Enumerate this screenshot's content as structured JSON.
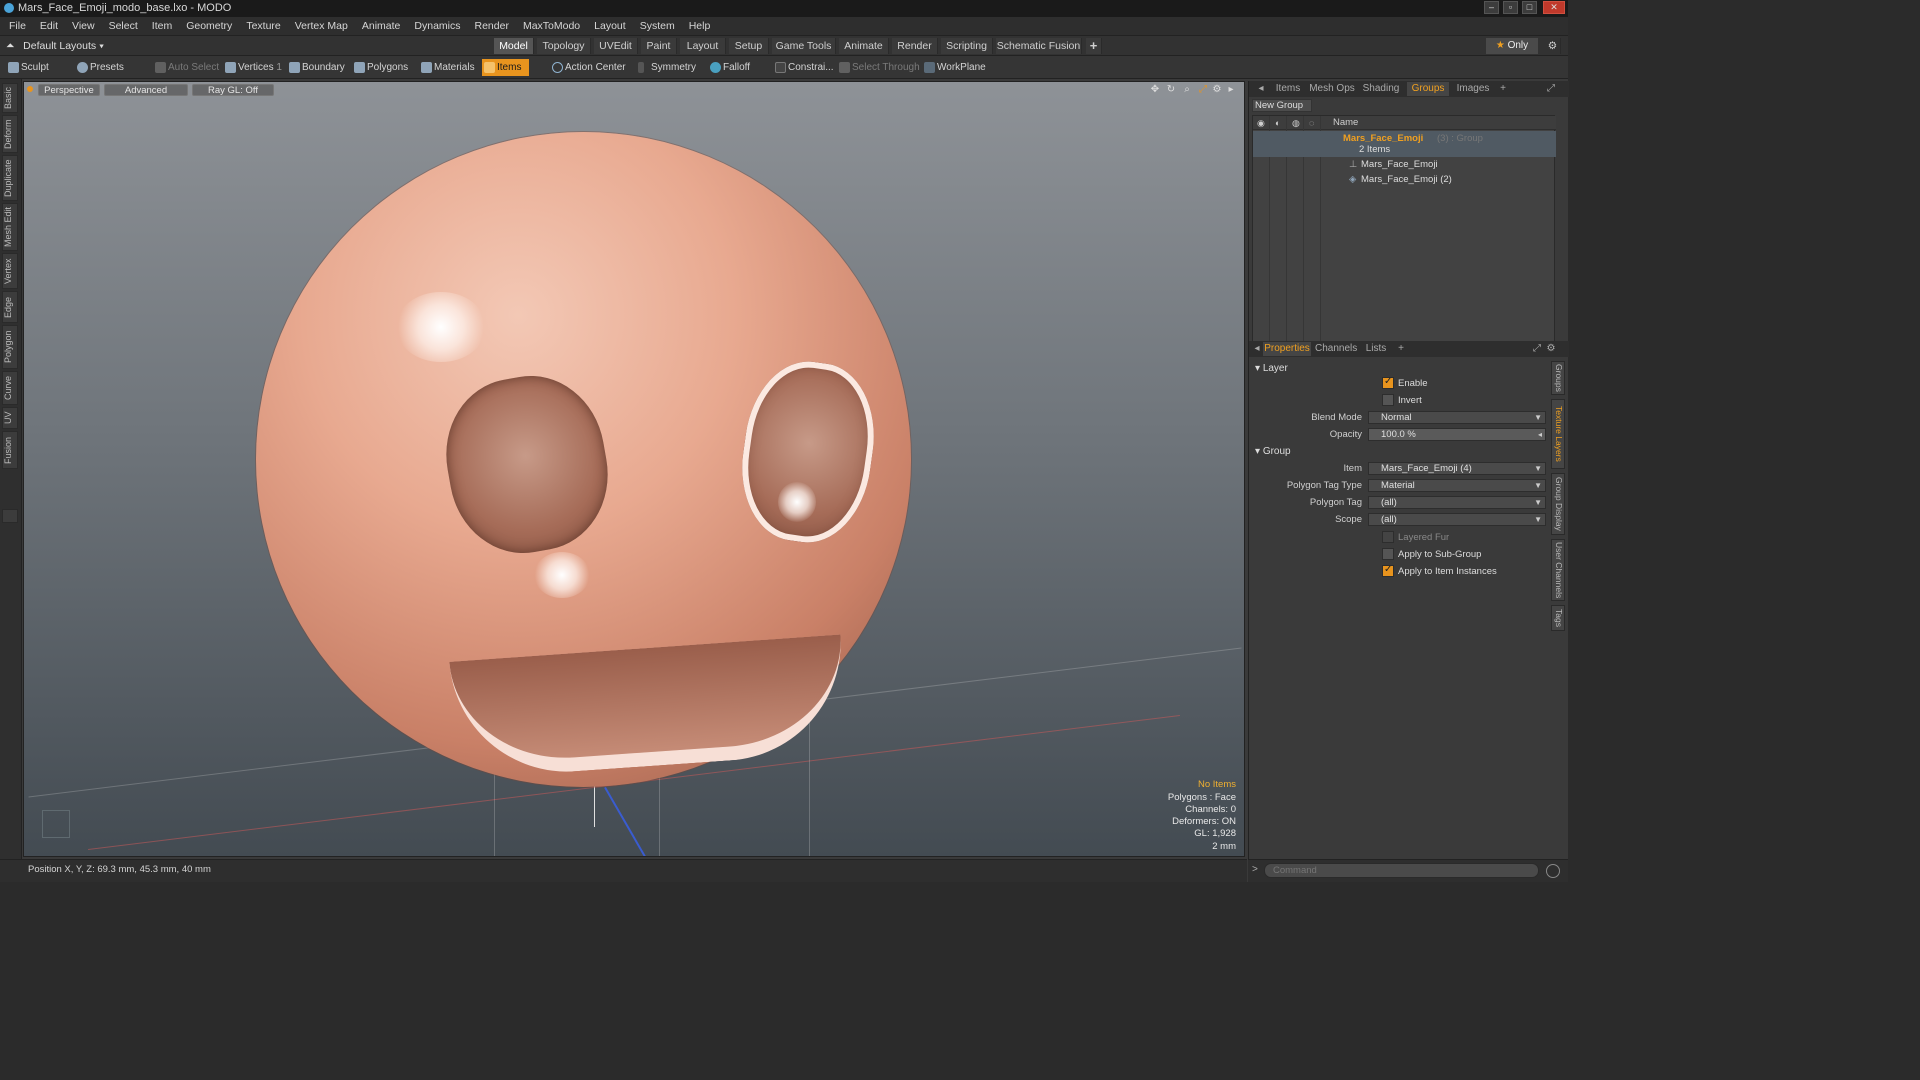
{
  "window": {
    "title": "Mars_Face_Emoji_modo_base.lxo - MODO"
  },
  "menu": [
    "File",
    "Edit",
    "View",
    "Select",
    "Item",
    "Geometry",
    "Texture",
    "Vertex Map",
    "Animate",
    "Dynamics",
    "Render",
    "MaxToModo",
    "Layout",
    "System",
    "Help"
  ],
  "layout_bar": {
    "layouts_label": "Default Layouts",
    "tabs": [
      "Model",
      "Topology",
      "UVEdit",
      "Paint",
      "Layout",
      "Setup",
      "Game Tools",
      "Animate",
      "Render",
      "Scripting",
      "Schematic Fusion"
    ],
    "active_tab": "Model",
    "add": "+",
    "only_label": "Only"
  },
  "toolbar": {
    "sculpt": "Sculpt",
    "presets": "Presets",
    "auto_select": "Auto Select",
    "vertices": "Vertices",
    "vertices_count": "1",
    "boundary": "Boundary",
    "polygons": "Polygons",
    "materials": "Materials",
    "items": "Items",
    "action_center": "Action Center",
    "symmetry": "Symmetry",
    "falloff": "Falloff",
    "constraints": "Constrai...",
    "select_through": "Select Through",
    "workplane": "WorkPlane"
  },
  "left_tabs": [
    "Basic",
    "Deform",
    "Duplicate",
    "Mesh Edit",
    "Vertex",
    "Edge",
    "Polygon",
    "Curve",
    "UV",
    "Fusion"
  ],
  "viewport": {
    "view": "Perspective",
    "shading": "Advanced",
    "raygl": "Ray GL: Off",
    "hud": {
      "selection": "No Items",
      "polygons": "Polygons : Face",
      "channels": "Channels: 0",
      "deformers": "Deformers: ON",
      "gl": "GL: 1,928",
      "scale": "2 mm"
    }
  },
  "top_panel": {
    "tabs": [
      "Items",
      "Mesh Ops",
      "Shading",
      "Groups",
      "Images"
    ],
    "active_tab": "Groups",
    "add": "+",
    "new_group": "New Group",
    "col_name": "Name",
    "group": {
      "name": "Mars_Face_Emoji",
      "suffix": "(3) : Group",
      "count": "2 Items"
    },
    "children": [
      "Mars_Face_Emoji",
      "Mars_Face_Emoji (2)"
    ]
  },
  "properties": {
    "tabs": [
      "Properties",
      "Channels",
      "Lists"
    ],
    "active_tab": "Properties",
    "add": "+",
    "layer_section": "Layer",
    "enable": {
      "label": "Enable",
      "checked": true
    },
    "invert": {
      "label": "Invert",
      "checked": false
    },
    "blend_mode": {
      "label": "Blend Mode",
      "value": "Normal"
    },
    "opacity": {
      "label": "Opacity",
      "value": "100.0 %"
    },
    "group_section": "Group",
    "item": {
      "label": "Item",
      "value": "Mars_Face_Emoji (4)"
    },
    "polygon_tag_type": {
      "label": "Polygon Tag Type",
      "value": "Material"
    },
    "polygon_tag": {
      "label": "Polygon Tag",
      "value": "(all)"
    },
    "scope": {
      "label": "Scope",
      "value": "(all)"
    },
    "layered_fur": {
      "label": "Layered Fur",
      "checked": true,
      "disabled": true
    },
    "apply_sub_group": {
      "label": "Apply to Sub-Group",
      "checked": false
    },
    "apply_item_instances": {
      "label": "Apply to Item Instances",
      "checked": true
    }
  },
  "right_tabs": [
    "Groups",
    "Texture Layers",
    "Group Display",
    "User Channels",
    "Tags"
  ],
  "right_tabs_active": "Texture Layers",
  "status": {
    "position": "Position X, Y, Z:  69.3 mm, 45.3 mm, 40 mm"
  },
  "command": {
    "placeholder": "Command"
  },
  "colors": {
    "accent": "#e8941e",
    "panel": "#3a3a3a",
    "highlight_text": "#f0a020"
  }
}
